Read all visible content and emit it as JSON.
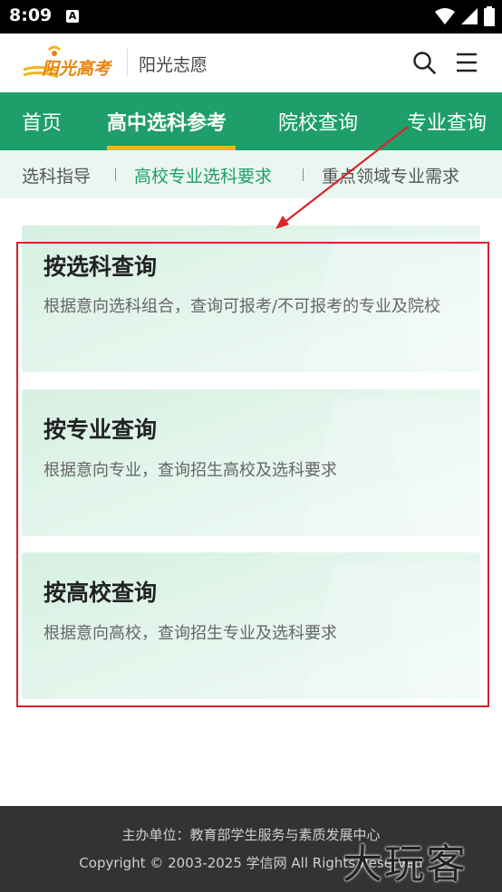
{
  "status_bar": {
    "time": "8:09",
    "notification_icon": "A",
    "icons": [
      "wifi-icon",
      "signal-icon",
      "battery-icon"
    ]
  },
  "header": {
    "logo_text": "阳光高考",
    "brand_sub": "阳光志愿",
    "search_icon": "search-icon",
    "menu_icon": "menu-icon"
  },
  "main_nav": {
    "tabs": [
      {
        "label": "首页"
      },
      {
        "label": "高中选科参考",
        "active": true
      },
      {
        "label": "院校查询"
      },
      {
        "label": "专业查询"
      }
    ]
  },
  "sub_nav": {
    "items": [
      {
        "label": "选科指导"
      },
      {
        "label": "高校专业选科要求",
        "active": true
      },
      {
        "label": "重点领域专业需求"
      }
    ]
  },
  "cards": [
    {
      "title": "按选科查询",
      "desc": "根据意向选科组合，查询可报考/不可报考的专业及院校"
    },
    {
      "title": "按专业查询",
      "desc": "根据意向专业，查询招生高校及选科要求"
    },
    {
      "title": "按高校查询",
      "desc": "根据意向高校，查询招生专业及选科要求"
    }
  ],
  "footer": {
    "line1": "主办单位：教育部学生服务与素质发展中心",
    "line2": "Copyright © 2003-2025 学信网 All Rights Reserved"
  },
  "watermark": "大玩客",
  "colors": {
    "primary_green": "#1e9e6a",
    "tab_underline": "#f0b51e",
    "annotation_red": "#d9232d",
    "footer_bg": "#333333"
  }
}
